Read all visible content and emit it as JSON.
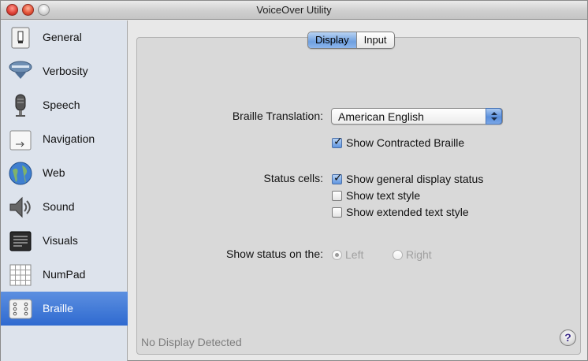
{
  "window": {
    "title": "VoiceOver Utility"
  },
  "sidebar": {
    "items": [
      {
        "label": "General",
        "icon": "general-icon",
        "selected": false
      },
      {
        "label": "Verbosity",
        "icon": "verbosity-icon",
        "selected": false
      },
      {
        "label": "Speech",
        "icon": "microphone-icon",
        "selected": false
      },
      {
        "label": "Navigation",
        "icon": "navigation-icon",
        "selected": false
      },
      {
        "label": "Web",
        "icon": "globe-icon",
        "selected": false
      },
      {
        "label": "Sound",
        "icon": "speaker-icon",
        "selected": false
      },
      {
        "label": "Visuals",
        "icon": "visuals-icon",
        "selected": false
      },
      {
        "label": "NumPad",
        "icon": "numpad-icon",
        "selected": false
      },
      {
        "label": "Braille",
        "icon": "braille-icon",
        "selected": true
      }
    ]
  },
  "tabs": {
    "display": "Display",
    "input": "Input",
    "active": "Display"
  },
  "braille_translation": {
    "label": "Braille Translation:",
    "value": "American English"
  },
  "show_contracted": {
    "label": "Show Contracted Braille",
    "checked": true
  },
  "status_cells": {
    "label": "Status cells:",
    "options": [
      {
        "label": "Show general display status",
        "checked": true
      },
      {
        "label": "Show text style",
        "checked": false
      },
      {
        "label": "Show extended text style",
        "checked": false
      }
    ]
  },
  "show_status_on": {
    "label": "Show status on the:",
    "options": [
      {
        "label": "Left",
        "selected": true,
        "enabled": false
      },
      {
        "label": "Right",
        "selected": false,
        "enabled": false
      }
    ]
  },
  "footer": {
    "status": "No Display Detected",
    "help": "?"
  },
  "colors": {
    "selection": "#3a74d8",
    "sidebar_bg": "#dde3ec",
    "panel_bg": "#d9d9d9"
  }
}
